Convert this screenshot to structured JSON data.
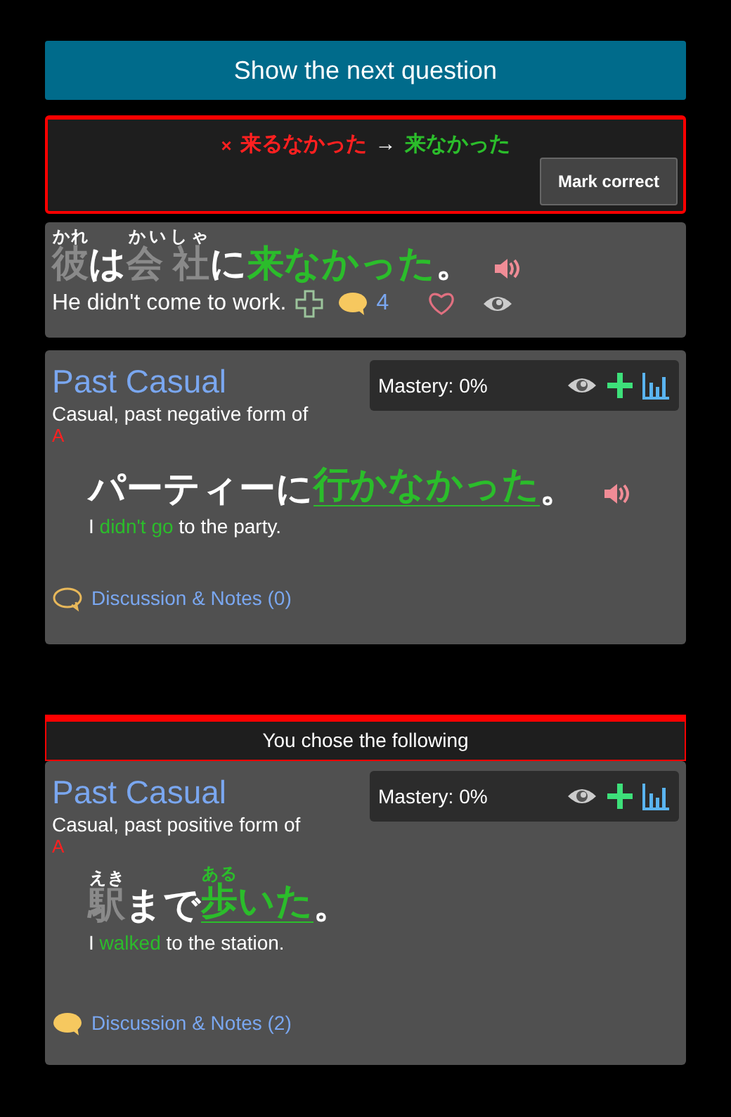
{
  "next_button": "Show the next question",
  "feedback": {
    "mark": "×",
    "wrong": "来るなかった",
    "arrow": "→",
    "correct": "来なかった",
    "button": "Mark correct"
  },
  "question": {
    "sentence": [
      {
        "text": "彼",
        "reading": "かれ",
        "kind": "kanji"
      },
      {
        "text": "は",
        "kind": "kana"
      },
      {
        "text": "会 社",
        "reading": "かいしゃ",
        "kind": "kanji"
      },
      {
        "text": "に",
        "kind": "kana"
      },
      {
        "text": "来なかった",
        "kind": "target"
      },
      {
        "text": "。",
        "kind": "kana"
      }
    ],
    "audio": true,
    "translation": "He didn't come to work.",
    "comment_count": "4"
  },
  "cards": [
    {
      "title": "Past Casual",
      "description": "Casual, past negative form of",
      "symbol": "A",
      "mastery": "Mastery: 0%",
      "audio": true,
      "sentence": [
        {
          "text": "パーティーに",
          "kind": "kana"
        },
        {
          "text": "行かなかった",
          "kind": "target"
        },
        {
          "text": "。",
          "kind": "kana"
        }
      ],
      "translation": [
        {
          "text": "I",
          "highlight": false
        },
        {
          "text": "didn't go",
          "highlight": true
        },
        {
          "text": "to the party.",
          "highlight": false
        }
      ],
      "notes": {
        "label": "Discussion & Notes (0)",
        "filled": false
      }
    },
    {
      "header": "You chose the following",
      "title": "Past Casual",
      "description": "Casual, past positive form of",
      "symbol": "A",
      "mastery": "Mastery: 0%",
      "audio": false,
      "sentence": [
        {
          "text": "駅",
          "reading": "えき",
          "kind": "kanji"
        },
        {
          "text": "まで",
          "kind": "kana"
        },
        {
          "text": "歩",
          "reading": "ある",
          "kind": "target"
        },
        {
          "text": "いた",
          "kind": "target"
        },
        {
          "text": "。",
          "kind": "kana"
        }
      ],
      "translation": [
        {
          "text": "I",
          "highlight": false
        },
        {
          "text": "walked",
          "highlight": true
        },
        {
          "text": "to the station.",
          "highlight": false
        }
      ],
      "notes": {
        "label": "Discussion & Notes (2)",
        "filled": true
      }
    }
  ]
}
